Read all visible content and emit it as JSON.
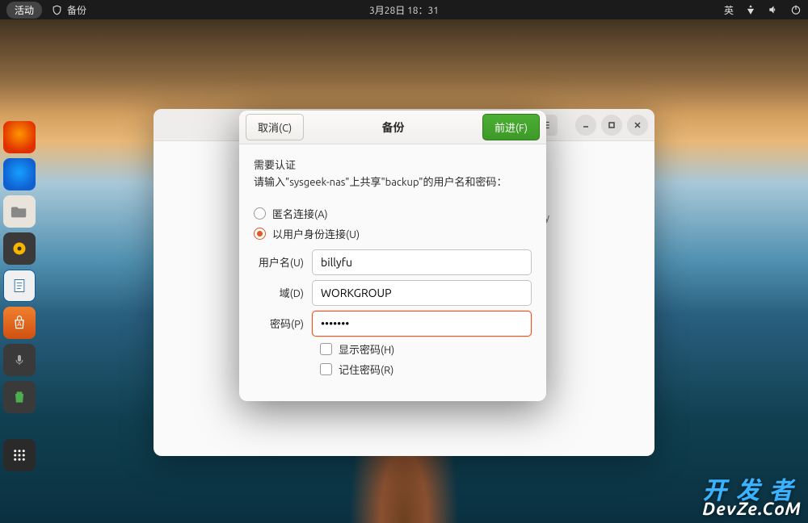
{
  "topbar": {
    "activities": "活动",
    "app_name": "备份",
    "datetime": "3月28日  18：31",
    "ime": "英"
  },
  "bgwin": {
    "partial_text": "y"
  },
  "dialog": {
    "cancel": "取消(C)",
    "title": "备份",
    "forward": "前进(F)",
    "auth_required": "需要认证",
    "auth_prompt": "请输入\"sysgeek-nas\"上共享\"backup\"的用户名和密码：",
    "radio_anon": "匿名连接(A)",
    "radio_user": "以用户身份连接(U)",
    "username_label": "用户名(U)",
    "username_value": "billyfu",
    "domain_label": "域(D)",
    "domain_value": "WORKGROUP",
    "password_label": "密码(P)",
    "password_value": "•••••••",
    "show_password": "显示密码(H)",
    "remember_password": "记住密码(R)"
  },
  "watermark": {
    "line1": "开 发 者",
    "line2": "DevZe.CoM"
  }
}
